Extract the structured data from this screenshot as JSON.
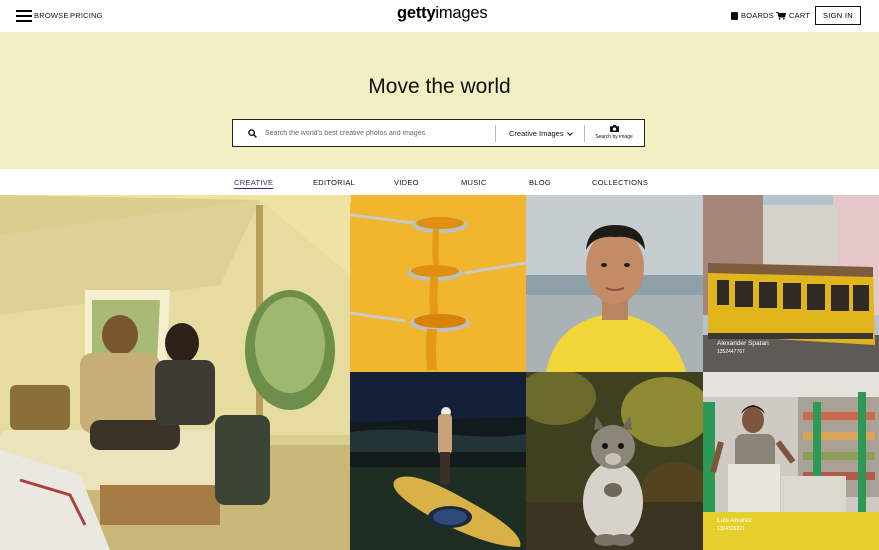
{
  "header": {
    "browse": "BROWSE",
    "pricing": "PRICING",
    "logo_bold": "getty",
    "logo_light": "images",
    "boards": "BOARDS",
    "cart": "CART",
    "sign_in": "SIGN IN"
  },
  "hero": {
    "title": "Move the world",
    "search_placeholder": "Search the world's best creative photos and images",
    "dropdown_value": "Creative Images",
    "search_by_image": "Search by image"
  },
  "tabs": [
    "CREATIVE",
    "EDITORIAL",
    "VIDEO",
    "MUSIC",
    "BLOG",
    "COLLECTIONS"
  ],
  "active_tab": "CREATIVE",
  "tiles": [
    {
      "name": "tent-couple-photo",
      "caption": "",
      "sub": ""
    },
    {
      "name": "honey-spoons-photo",
      "caption": "",
      "sub": ""
    },
    {
      "name": "portrait-yellow-shirt-photo",
      "caption": "",
      "sub": ""
    },
    {
      "name": "tram-photo",
      "caption": "Alexander Spatari",
      "sub": "1352447767"
    },
    {
      "name": "kayak-night-photo",
      "caption": "",
      "sub": ""
    },
    {
      "name": "squirrel-photo",
      "caption": "",
      "sub": ""
    },
    {
      "name": "grocery-worker-photo",
      "caption": "Luis Alvarez",
      "sub": "1304326221"
    }
  ],
  "colors": {
    "hero_bg": "#f2efc3",
    "active_tab": "#3d2d7a"
  }
}
